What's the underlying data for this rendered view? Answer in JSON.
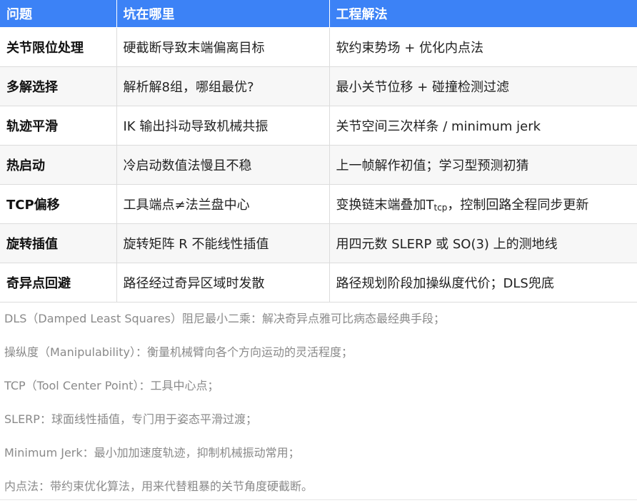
{
  "table": {
    "headers": [
      "问题",
      "坑在哪里",
      "工程解法"
    ],
    "rows": [
      {
        "problem": "关节限位处理",
        "pitfall": "硬截断导致末端偏离目标",
        "solution": "软约束势场 + 优化内点法"
      },
      {
        "problem": "多解选择",
        "pitfall": "解析解8组，哪组最优?",
        "solution": "最小关节位移 + 碰撞检测过滤"
      },
      {
        "problem": "轨迹平滑",
        "pitfall": "IK 输出抖动导致机械共振",
        "solution": "关节空间三次样条 / minimum jerk"
      },
      {
        "problem": "热启动",
        "pitfall": "冷启动数值法慢且不稳",
        "solution": "上一帧解作初值；学习型预测初猜"
      },
      {
        "problem": "TCP偏移",
        "pitfall": "工具端点≠法兰盘中心",
        "solution_pre": "变换链末端叠加T",
        "solution_sub": "tcp",
        "solution_post": "，控制回路全程同步更新"
      },
      {
        "problem": "旋转插值",
        "pitfall": "旋转矩阵 R 不能线性插值",
        "solution": "用四元数 SLERP 或 SO(3) 上的测地线"
      },
      {
        "problem": "奇异点回避",
        "pitfall": "路径经过奇异区域时发散",
        "solution": "路径规划阶段加操纵度代价；DLS兜底"
      }
    ]
  },
  "notes": [
    "DLS（Damped Least Squares）阻尼最小二乘：解决奇异点雅可比病态最经典手段；",
    "操纵度（Manipulability）：衡量机械臂向各个方向运动的灵活程度；",
    "TCP（Tool Center Point）：工具中心点；",
    "SLERP：球面线性插值，专门用于姿态平滑过渡；",
    "Minimum Jerk：最小加加速度轨迹，抑制机械振动常用；",
    "内点法：带约束优化算法，用来代替粗暴的关节角度硬截断。"
  ]
}
